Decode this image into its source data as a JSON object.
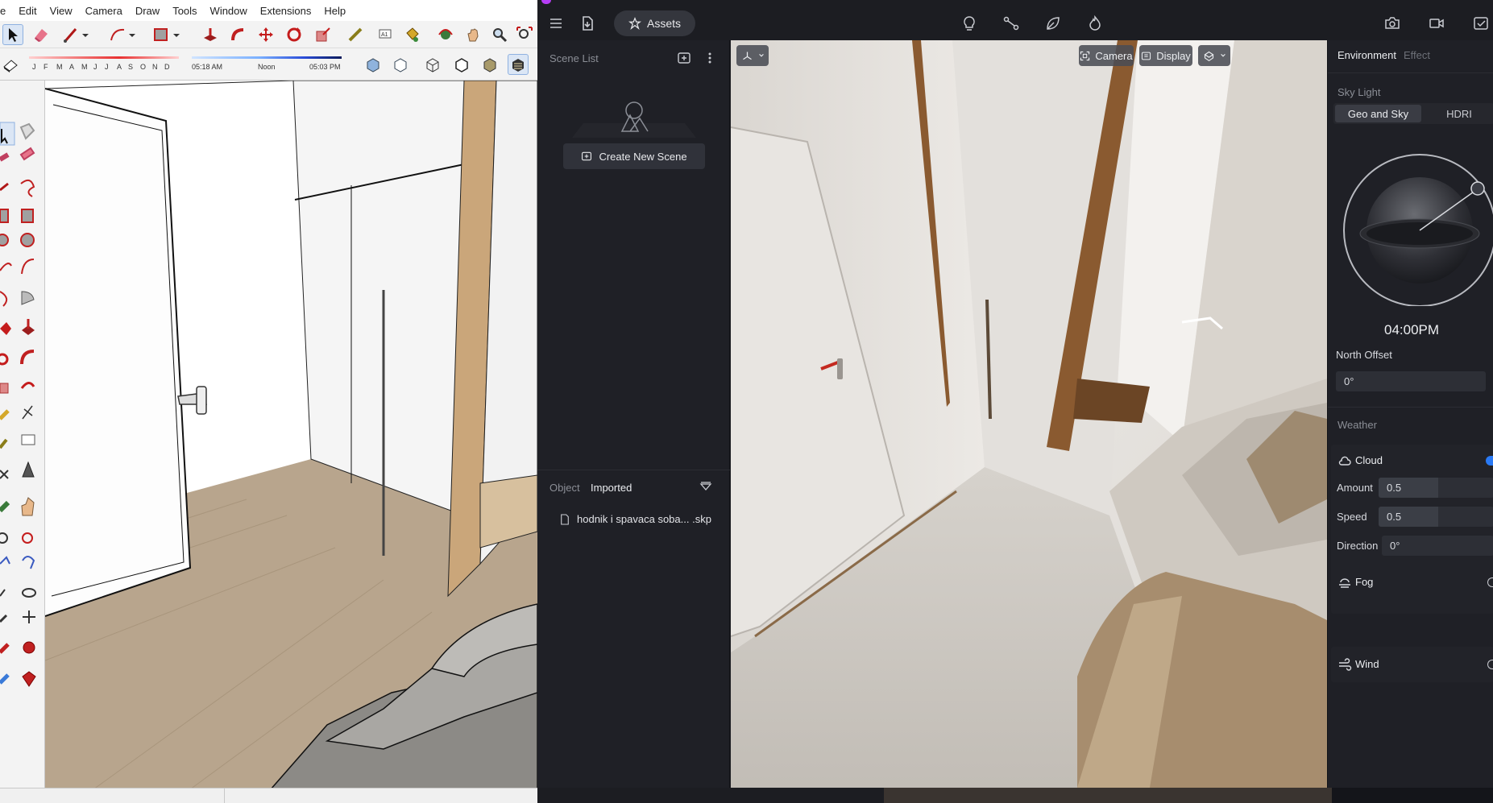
{
  "sketchup": {
    "menu": [
      "e",
      "Edit",
      "View",
      "Camera",
      "Draw",
      "Tools",
      "Window",
      "Extensions",
      "Help"
    ],
    "shadow_months": [
      "J",
      "F",
      "M",
      "A",
      "M",
      "J",
      "J",
      "A",
      "S",
      "O",
      "N",
      "D"
    ],
    "shadow_time_start": "05:18 AM",
    "shadow_time_mid": "Noon",
    "shadow_time_end": "05:03 PM"
  },
  "d5": {
    "assets_label": "Assets",
    "scene_list_title": "Scene List",
    "create_scene_label": "Create New Scene",
    "object_tab": "Object",
    "imported_tab": "Imported",
    "imported_file": "hodnik i spavaca soba... .skp",
    "viewport": {
      "camera_label": "Camera",
      "display_label": "Display"
    },
    "environment": {
      "tab_environment": "Environment",
      "tab_effect": "Effect",
      "sky_light_title": "Sky Light",
      "mode_geo_sky": "Geo and Sky",
      "mode_hdri": "HDRI",
      "time": "04:00PM",
      "north_offset_label": "North Offset",
      "north_offset_value": "0°",
      "weather_title": "Weather",
      "cloud_label": "Cloud",
      "amount_label": "Amount",
      "amount_value": "0.5",
      "speed_label": "Speed",
      "speed_value": "0.5",
      "direction_label": "Direction",
      "direction_value": "0°",
      "fog_label": "Fog",
      "wind_label": "Wind"
    }
  }
}
